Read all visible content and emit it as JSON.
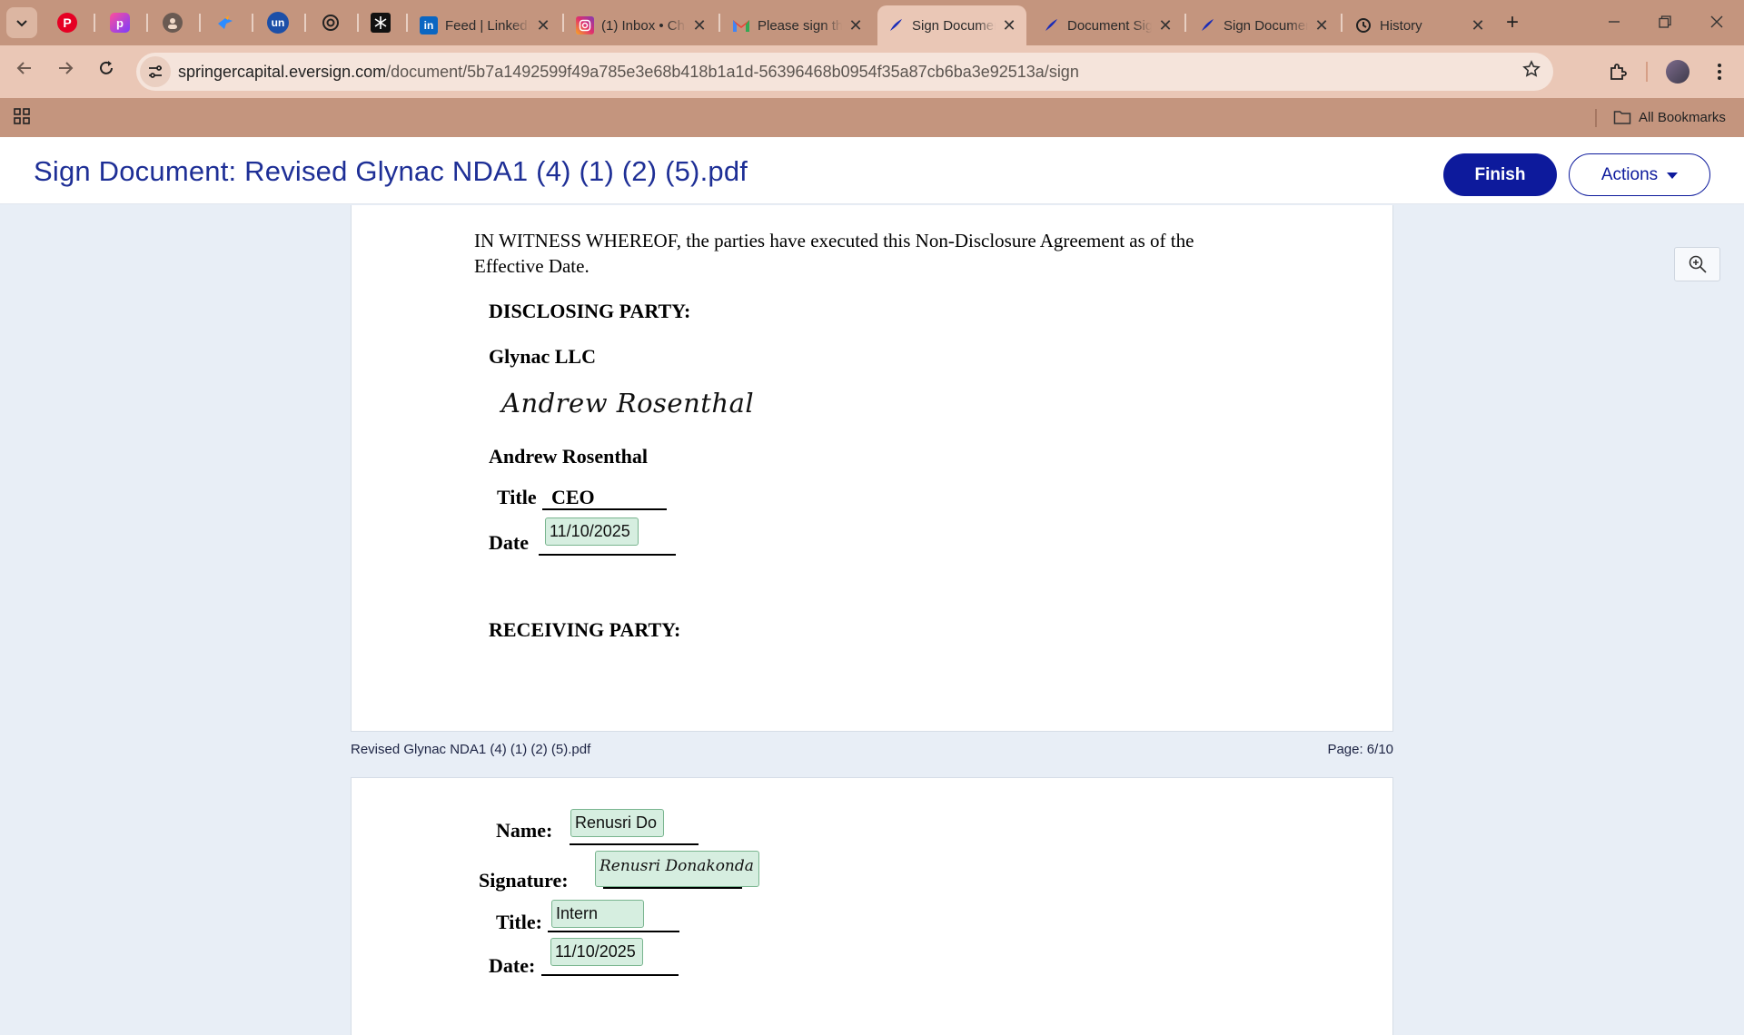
{
  "browser": {
    "tabs": [
      {
        "title": "Feed | LinkedIn",
        "icon": "linkedin-icon"
      },
      {
        "title": "(1) Inbox • Chats",
        "icon": "instagram-icon"
      },
      {
        "title": "Please sign the document",
        "icon": "gmail-icon"
      },
      {
        "title": "Sign Document",
        "icon": "eversign-icon",
        "active": true
      },
      {
        "title": "Document Signed",
        "icon": "eversign-icon"
      },
      {
        "title": "Sign Document",
        "icon": "eversign-icon"
      },
      {
        "title": "History",
        "icon": "history-icon"
      }
    ],
    "url_host": "springercapital.eversign.com",
    "url_path": "/document/5b7a1492599f49a785e3e68b418b1a1d-56396468b0954f35a87cb6ba3e92513a/sign",
    "bookmarks_label": "All Bookmarks"
  },
  "header": {
    "title": "Sign Document: Revised Glynac NDA1 (4) (1) (2) (5).pdf",
    "finish_label": "Finish",
    "actions_label": "Actions"
  },
  "document": {
    "file_name": "Revised Glynac NDA1 (4) (1) (2) (5).pdf",
    "page_indicator": "Page: 6/10",
    "witness_line1": "IN WITNESS WHEREOF, the parties have executed this Non-Disclosure Agreement as of the",
    "witness_line2": "Effective Date.",
    "disclosing_label": "DISCLOSING PARTY:",
    "disclosing_company": "Glynac LLC",
    "disclosing_signature": "Andrew Rosenthal",
    "disclosing_name": "Andrew Rosenthal",
    "title_label": "Title",
    "disclosing_title": "CEO",
    "date_label": "Date",
    "disclosing_date": "11/10/2025",
    "receiving_label": "RECEIVING PARTY:",
    "name_label": "Name:",
    "receiving_name": "Renusri Do",
    "signature_label": "Signature:",
    "receiving_signature": "Renusri Donakonda",
    "receiving_title_label": "Title:",
    "receiving_title": "Intern",
    "receiving_date_label": "Date:",
    "receiving_date": "11/10/2025"
  }
}
